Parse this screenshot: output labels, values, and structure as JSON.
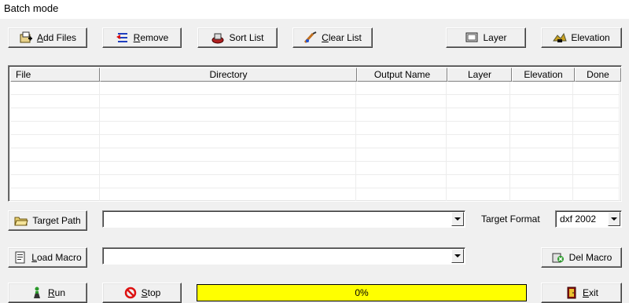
{
  "window": {
    "title": "Batch mode"
  },
  "toolbar": {
    "add_files": {
      "label_u": "A",
      "label_rest": "dd Files",
      "icon": "add-files-icon"
    },
    "remove": {
      "label_u": "R",
      "label_rest": "emove",
      "icon": "remove-icon"
    },
    "sort_list": {
      "label": "Sort List",
      "icon": "sort-list-icon"
    },
    "clear_list": {
      "label_u": "C",
      "label_rest": "lear List",
      "icon": "clear-list-icon"
    },
    "layer": {
      "label": "Layer",
      "icon": "layer-icon"
    },
    "elevation": {
      "label": "Elevation",
      "icon": "elevation-icon"
    }
  },
  "file_list": {
    "columns": [
      "File",
      "Directory",
      "Output Name",
      "Layer",
      "Elevation",
      "Done"
    ],
    "rows": []
  },
  "target_path": {
    "button_label": "Target Path",
    "value": ""
  },
  "target_format": {
    "label": "Target Format",
    "value": "dxf 2002"
  },
  "load_macro": {
    "button_label_u": "L",
    "button_label_rest": "oad Macro",
    "value": ""
  },
  "del_macro": {
    "label": "Del Macro"
  },
  "actions": {
    "run": {
      "label_u": "R",
      "label_rest": "un"
    },
    "stop": {
      "label_u": "S",
      "label_rest": "top"
    },
    "exit": {
      "label_u": "E",
      "label_rest": "xit"
    }
  },
  "progress": {
    "percent": 0,
    "text": "0%"
  },
  "colors": {
    "progress_fill": "#ffff00",
    "window_bg": "#f0f0f0"
  }
}
